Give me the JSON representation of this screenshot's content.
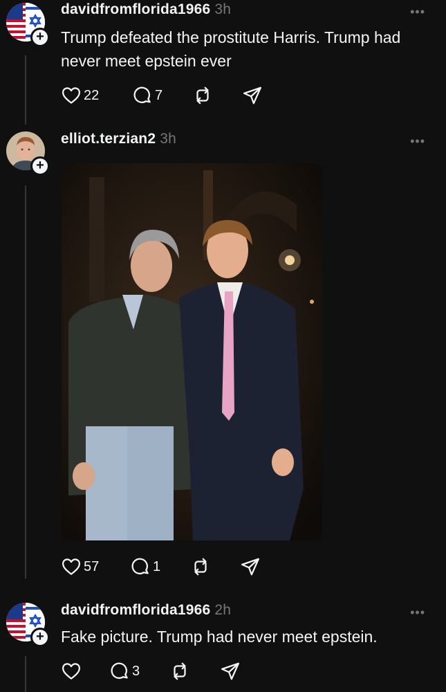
{
  "posts": [
    {
      "username": "davidfromflorida1966",
      "time": "3h",
      "text": "Trump defeated the prostitute Harris.  Trump had never meet epstein ever",
      "likes": "22",
      "replies": "7",
      "more": "•••"
    },
    {
      "username": "elliot.terzian2",
      "time": "3h",
      "image": "photo of two men in suits",
      "likes": "57",
      "replies": "1",
      "more": "•••"
    },
    {
      "username": "davidfromflorida1966",
      "time": "2h",
      "text": "Fake picture.  Trump had never meet epstein.",
      "likes": "",
      "replies": "3",
      "more": "•••"
    }
  ],
  "icons": {
    "like": "heart-icon",
    "reply": "comment-icon",
    "repost": "repost-icon",
    "share": "send-icon",
    "follow": "plus-icon"
  },
  "colors": {
    "background": "#101010",
    "text": "#f3f5f7",
    "muted": "#777777"
  }
}
